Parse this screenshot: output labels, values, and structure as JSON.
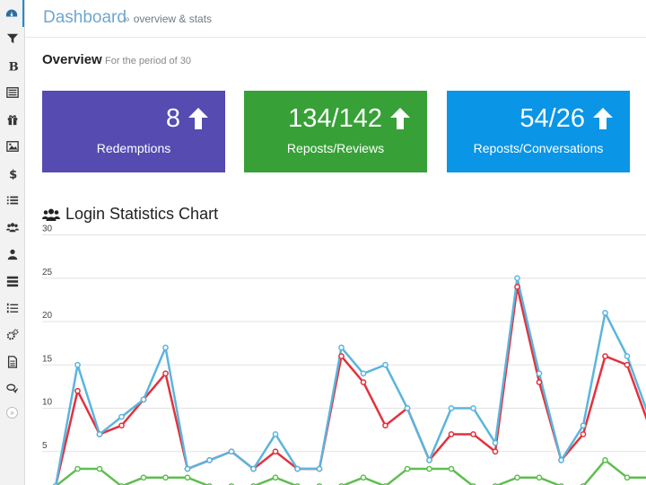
{
  "header": {
    "title": "Dashboard",
    "breadcrumb_sep": "»",
    "breadcrumb_text": "overview & stats"
  },
  "overview": {
    "title": "Overview",
    "subtitle": "For the period of 30"
  },
  "sidebar": {
    "items": [
      {
        "icon": "dashboard-icon"
      },
      {
        "icon": "filter-icon"
      },
      {
        "icon": "bold-icon"
      },
      {
        "icon": "list-alt-icon"
      },
      {
        "icon": "gift-icon"
      },
      {
        "icon": "picture-icon"
      },
      {
        "icon": "dollar-icon"
      },
      {
        "icon": "list-icon"
      },
      {
        "icon": "group-icon"
      },
      {
        "icon": "user-icon"
      },
      {
        "icon": "tasks-icon"
      },
      {
        "icon": "list-ol-icon"
      },
      {
        "icon": "cogs-icon"
      },
      {
        "icon": "file-icon"
      },
      {
        "icon": "comments-icon"
      }
    ],
    "collapse_icon": "double-chevron-right-icon",
    "collapse_label": "»"
  },
  "cards": [
    {
      "value": "8",
      "label": "Redemptions",
      "color": "#554bb1"
    },
    {
      "value": "134/142",
      "label": "Reposts/Reviews",
      "color": "#37a137"
    },
    {
      "value": "54/26",
      "label": "Reposts/Conversations",
      "color": "#0a95e6"
    }
  ],
  "chart_data": {
    "type": "line",
    "title": "Login Statistics Chart",
    "ylim": [
      0,
      30
    ],
    "y_ticks": [
      30,
      25,
      20,
      15,
      10,
      5
    ],
    "grid": true,
    "x": [
      0,
      1,
      2,
      3,
      4,
      5,
      6,
      7,
      8,
      9,
      10,
      11,
      12,
      13,
      14,
      15,
      16,
      17,
      18,
      19,
      20,
      21,
      22,
      23,
      24,
      25,
      26,
      27
    ],
    "series": [
      {
        "color": "#5bb5dd",
        "values": [
          1,
          15,
          7,
          9,
          11,
          17,
          3,
          4,
          5,
          3,
          7,
          3,
          3,
          17,
          14,
          15,
          10,
          4,
          10,
          10,
          6,
          25,
          14,
          4,
          8,
          21,
          16,
          9
        ]
      },
      {
        "color": "#e2323d",
        "values": [
          1,
          12,
          7,
          8,
          11,
          14,
          3,
          4,
          5,
          3,
          5,
          3,
          3,
          16,
          13,
          8,
          10,
          4,
          7,
          7,
          5,
          24,
          13,
          4,
          7,
          16,
          15,
          8
        ]
      },
      {
        "color": "#5fbe50",
        "values": [
          1,
          3,
          3,
          1,
          2,
          2,
          2,
          1,
          1,
          1,
          2,
          1,
          1,
          1,
          2,
          1,
          3,
          3,
          3,
          1,
          1,
          2,
          2,
          1,
          1,
          4,
          2,
          2
        ]
      }
    ]
  }
}
